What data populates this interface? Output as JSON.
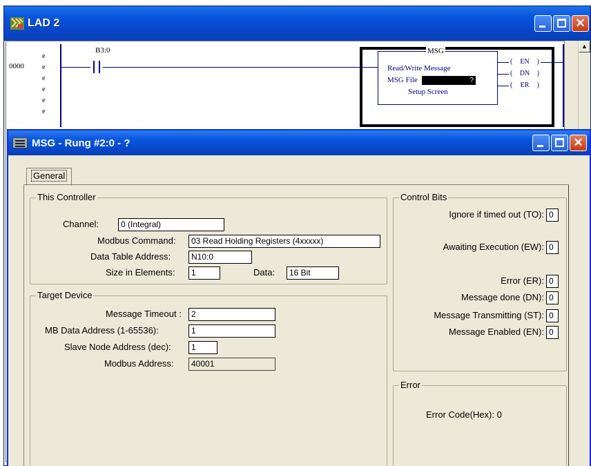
{
  "lad_window": {
    "title": "LAD 2",
    "rung_number": "0000",
    "rung_markers": [
      "e",
      "e",
      "e",
      "e",
      "e",
      "e"
    ],
    "contact_address": "B3:0",
    "msg_block": {
      "title": "MSG",
      "line1": "Read/Write Message",
      "file_label": "MSG File",
      "file_value": "?",
      "line3": "Setup Screen"
    },
    "coils": [
      "EN",
      "DN",
      "ER"
    ],
    "scroll_up": "▲"
  },
  "dialog": {
    "title": "MSG - Rung #2:0 - ?",
    "tab_general": "General",
    "this_controller": {
      "legend": "This Controller",
      "channel_label": "Channel:",
      "channel_value": "0 (Integral)",
      "modbus_command_label": "Modbus Command:",
      "modbus_command_value": "03 Read Holding Registers (4xxxxx)",
      "data_table_address_label": "Data Table Address:",
      "data_table_address_value": "N10:0",
      "size_label": "Size in Elements:",
      "size_value": "1",
      "data_label": "Data:",
      "data_value": "16 Bit"
    },
    "target_device": {
      "legend": "Target Device",
      "timeout_label": "Message Timeout :",
      "timeout_value": "2",
      "mb_data_address_label": "MB Data Address (1-65536):",
      "mb_data_address_value": "1",
      "slave_node_label": "Slave Node Address (dec):",
      "slave_node_value": "1",
      "modbus_address_label": "Modbus Address:",
      "modbus_address_value": "40001"
    },
    "control_bits": {
      "legend": "Control Bits",
      "to_label": "Ignore if timed out (TO):",
      "to_value": "0",
      "ew_label": "Awaiting Execution (EW):",
      "ew_value": "0",
      "er_label": "Error (ER):",
      "er_value": "0",
      "dn_label": "Message done (DN):",
      "dn_value": "0",
      "st_label": "Message Transmitting (ST):",
      "st_value": "0",
      "en_label": "Message Enabled (EN):",
      "en_value": "0"
    },
    "error": {
      "legend": "Error",
      "error_code_text": "Error Code(Hex): 0"
    }
  },
  "window_buttons": {
    "minimize": "",
    "maximize": "",
    "close": "✕"
  },
  "colors": {
    "titlebar_blue": "#0855dd",
    "dialog_face": "#ece9d8",
    "ladder_rung": "#00008b",
    "close_red": "#c83a12"
  }
}
